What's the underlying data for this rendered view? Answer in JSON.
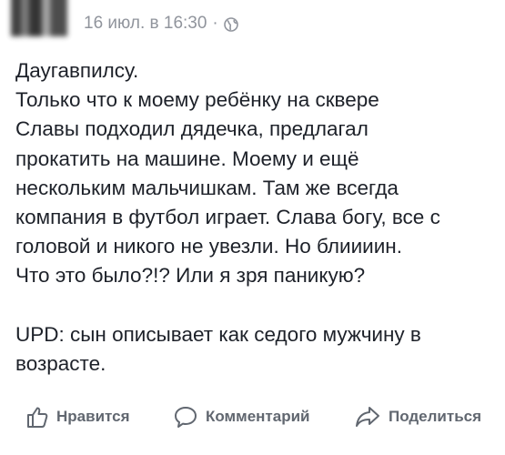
{
  "post": {
    "timestamp": "16 июл. в 16:30",
    "separator": "·",
    "privacy_icon": "globe-icon",
    "text": "Даугавпилсу.\nТолько что к моему ребёнку на сквере\nСлавы подходил дядечка, предлагал\nпрокатить на машине. Моему и ещё\nнескольким мальчишкам. Там же всегда\nкомпания в футбол играет. Слава богу, все с\nголовой и никого не увезли. Но блиииин.\nЧто это было?!? Или я зря паникую?\n\nUPD: сын описывает как седого мужчину в\nвозрасте."
  },
  "actions": {
    "like_label": "Нравится",
    "comment_label": "Комментарий",
    "share_label": "Поделиться"
  },
  "colors": {
    "text": "#1d2129",
    "meta": "#90949c",
    "action": "#616770"
  }
}
